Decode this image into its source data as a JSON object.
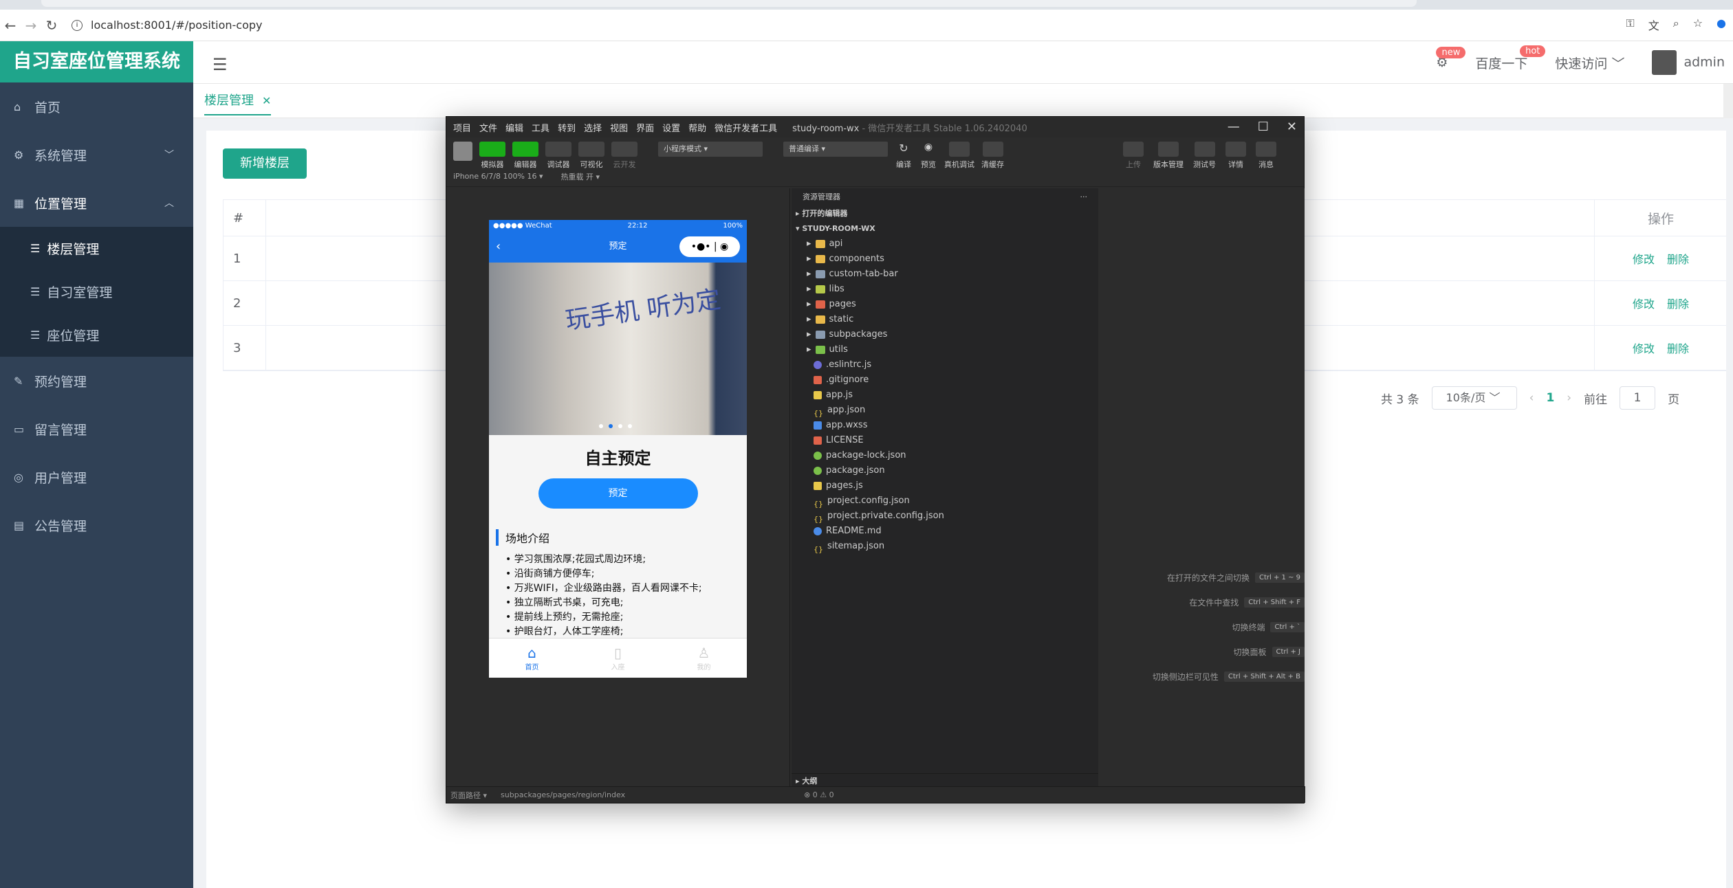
{
  "browser": {
    "url": "localhost:8001/#/position-copy"
  },
  "app": {
    "title": "自习室座位管理系统"
  },
  "sidebar": {
    "items": [
      {
        "label": "首页",
        "icon": "home-icon"
      },
      {
        "label": "系统管理",
        "icon": "gear-icon"
      },
      {
        "label": "位置管理",
        "icon": "grid-icon"
      },
      {
        "label": "楼层管理",
        "icon": "list-icon"
      },
      {
        "label": "自习室管理",
        "icon": "list-icon"
      },
      {
        "label": "座位管理",
        "icon": "list-icon"
      },
      {
        "label": "预约管理",
        "icon": "edit-icon"
      },
      {
        "label": "留言管理",
        "icon": "message-icon"
      },
      {
        "label": "用户管理",
        "icon": "user-icon"
      },
      {
        "label": "公告管理",
        "icon": "document-icon"
      }
    ]
  },
  "header": {
    "badge_new": "new",
    "baidu": "百度一下",
    "badge_hot": "hot",
    "quick": "快速访问",
    "user": "admin"
  },
  "tags": {
    "active": "楼层管理"
  },
  "page": {
    "add_button": "新增楼层",
    "col_index": "#",
    "col_op": "操作",
    "rows": [
      {
        "index": "1",
        "edit": "修改",
        "del": "删除"
      },
      {
        "index": "2",
        "edit": "修改",
        "del": "删除"
      },
      {
        "index": "3",
        "edit": "修改",
        "del": "删除"
      }
    ],
    "pager": {
      "total": "共 3 条",
      "size": "10条/页",
      "current": "1",
      "goto": "前往",
      "goto_value": "1",
      "unit": "页"
    }
  },
  "devtools": {
    "menu": [
      "项目",
      "文件",
      "编辑",
      "工具",
      "转到",
      "选择",
      "视图",
      "界面",
      "设置",
      "帮助",
      "微信开发者工具"
    ],
    "title": "study-room-wx",
    "version": "- 微信开发者工具 Stable 1.06.2402040",
    "tools": [
      "模拟器",
      "编辑器",
      "调试器",
      "可视化",
      "云开发"
    ],
    "mode": "小程序模式",
    "compile": "普通编译",
    "actions": [
      "编译",
      "预览",
      "真机调试",
      "清缓存"
    ],
    "right_actions": [
      "上传",
      "版本管理",
      "测试号",
      "详情",
      "消息"
    ],
    "device": "iPhone 6/7/8 100% 16 ▾",
    "hot_reload": "热重载 开 ▾",
    "phone": {
      "carrier": "●●●●● WeChat",
      "time": "22:12",
      "battery": "100%",
      "nav_title": "预定",
      "banner_text": "玩手机 听为定",
      "heading": "自主预定",
      "button": "预定",
      "intro_title": "场地介绍",
      "intro": [
        "学习氛围浓厚;花园式周边环境;",
        "沿街商铺方便停车;",
        "万兆WIFI，企业级路由器，百人看网课不卡;",
        "独立隔断式书桌，可充电;",
        "提前线上预约，无需抢座;",
        "护眼台灯，人体工学座椅;"
      ],
      "tabs": [
        "首页",
        "入座",
        "我的"
      ]
    },
    "explorer": {
      "title": "资源管理器",
      "open_editors": "打开的编辑器",
      "root": "STUDY-ROOM-WX",
      "folders": [
        "api",
        "components",
        "custom-tab-bar",
        "libs",
        "pages",
        "static",
        "subpackages",
        "utils"
      ],
      "files": [
        ".eslintrc.js",
        ".gitignore",
        "app.js",
        "app.json",
        "app.wxss",
        "LICENSE",
        "package-lock.json",
        "package.json",
        "pages.js",
        "project.config.json",
        "project.private.config.json",
        "README.md",
        "sitemap.json"
      ],
      "outline": "大纲"
    },
    "shortcuts": [
      {
        "label": "在打开的文件之间切换",
        "keys": "Ctrl + 1 ~ 9"
      },
      {
        "label": "在文件中查找",
        "keys": "Ctrl + Shift + F"
      },
      {
        "label": "切换终端",
        "keys": "Ctrl + `"
      },
      {
        "label": "切换面板",
        "keys": "Ctrl + J"
      },
      {
        "label": "切换侧边栏可见性",
        "keys": "Ctrl + Shift + Alt + B"
      }
    ],
    "footer": {
      "path_label": "页面路径 ▾",
      "path": "subpackages/pages/region/index",
      "errors": "⊗ 0 ⚠ 0"
    }
  }
}
